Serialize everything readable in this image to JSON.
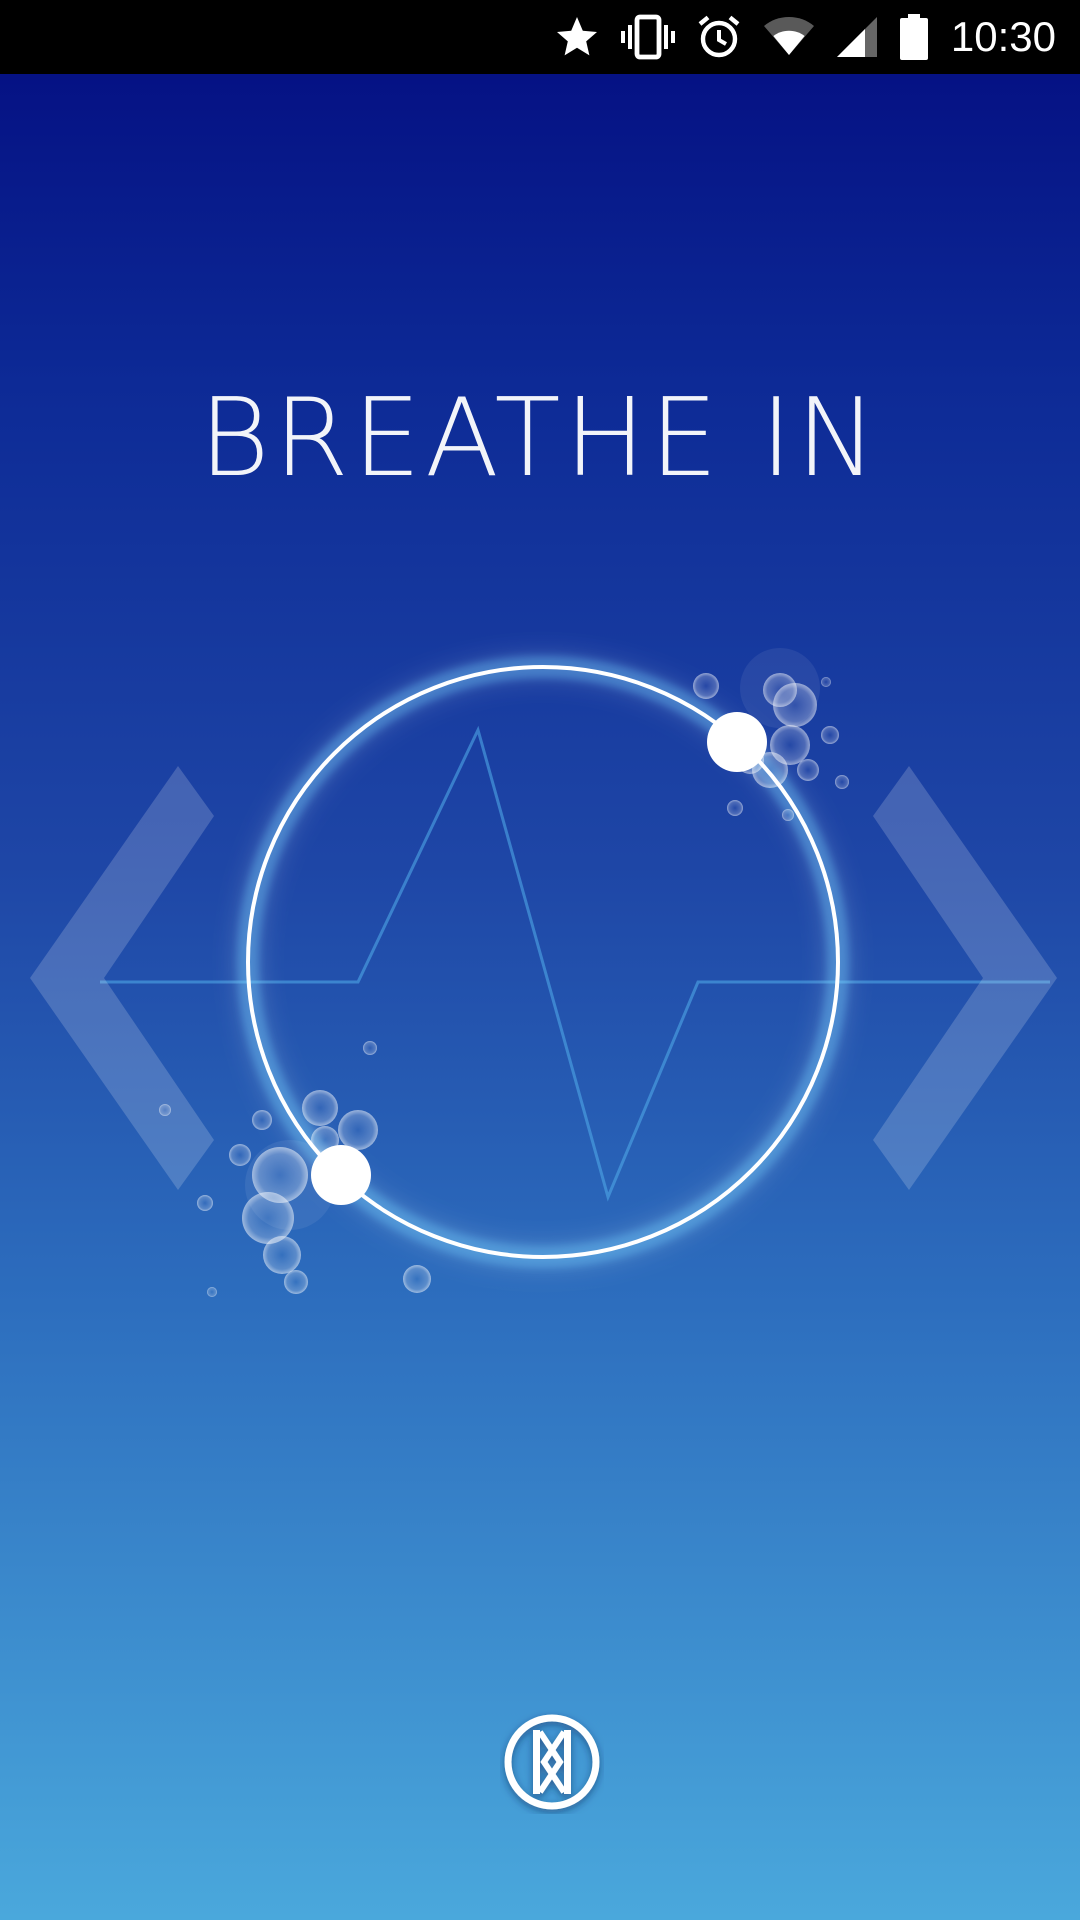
{
  "status_bar": {
    "time": "10:30",
    "icons": [
      "star-icon",
      "vibrate-icon",
      "alarm-icon",
      "wifi-icon",
      "cell-signal-icon",
      "battery-icon"
    ]
  },
  "title": "BREATHE IN",
  "controls": {
    "prev_icon": "chevron-left-icon",
    "next_icon": "chevron-right-icon",
    "logo_icon": "app-logo-icon"
  },
  "colors": {
    "ring": "#ffffff",
    "glow": "#5cc8ff",
    "background_top": "#030c80",
    "background_bottom": "#4aa8dc"
  }
}
